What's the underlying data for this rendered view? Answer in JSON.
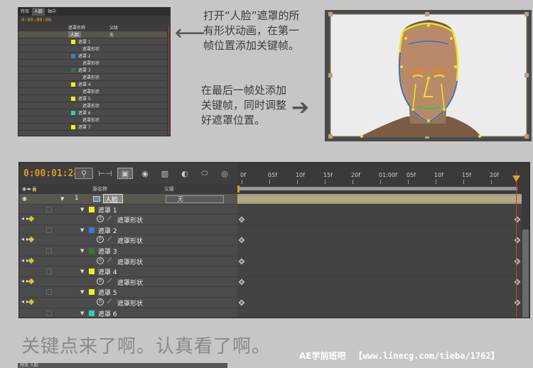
{
  "thumbnail": {
    "tabs": [
      "特效",
      "人脸",
      "轴中"
    ],
    "timecode": "0:00:00:00",
    "header_name": "遮罩名称",
    "header_parent": "父级",
    "layer_name": "人脸",
    "parent_value": "无",
    "rows": [
      {
        "type": "mask",
        "label": "遮罩 1",
        "color": "#f2f200"
      },
      {
        "type": "prop",
        "label": "遮罩形状"
      },
      {
        "type": "mask",
        "label": "遮罩 2",
        "color": "#2f7ed8"
      },
      {
        "type": "prop",
        "label": "遮罩形状"
      },
      {
        "type": "mask",
        "label": "遮罩 3",
        "color": "#2e7a2e"
      },
      {
        "type": "prop",
        "label": "遮罩形状"
      },
      {
        "type": "mask",
        "label": "遮罩 4",
        "color": "#f2f200"
      },
      {
        "type": "prop",
        "label": "遮罩形状"
      },
      {
        "type": "mask",
        "label": "遮罩 5",
        "color": "#f2f200"
      },
      {
        "type": "prop",
        "label": "遮罩形状"
      },
      {
        "type": "mask",
        "label": "遮罩 6",
        "color": "#27d3b5"
      },
      {
        "type": "prop",
        "label": "遮罩形状"
      },
      {
        "type": "mask",
        "label": "遮罩 7",
        "color": "#f2f200"
      }
    ]
  },
  "notes": {
    "note1": "打开“人脸”遮罩的所有形状动画，在第一帧位置添加关键帧。",
    "note2": "在最后一帧处添加关键帧，同时调整好遮罩位置。"
  },
  "timeline": {
    "timecode": "0:00:01:24",
    "toolbar_icons": [
      "search-icon",
      "comp-flowchart-icon",
      "draft-3d-icon",
      "shy-icon",
      "frame-blend-icon",
      "motion-blur-icon",
      "brainstorm-icon",
      "graph-editor-icon",
      "comp-flowchart-toggle-icon"
    ],
    "ruler_labels": [
      "0f",
      "05f",
      "10f",
      "15f",
      "20f",
      "01:00f",
      "05f",
      "10f",
      "15f",
      "20f"
    ],
    "header_name": "源名称",
    "header_parent": "父级",
    "layer": {
      "number": "1",
      "name": "人脸",
      "parent": "无"
    },
    "rows": [
      {
        "type": "mask",
        "label": "遮罩 1",
        "color": "#f2f200"
      },
      {
        "type": "prop",
        "label": "遮罩形状"
      },
      {
        "type": "mask",
        "label": "遮罩 2",
        "color": "#2f7ed8"
      },
      {
        "type": "prop",
        "label": "遮罩形状"
      },
      {
        "type": "mask",
        "label": "遮罩 3",
        "color": "#2e7a2e"
      },
      {
        "type": "prop",
        "label": "遮罩形状"
      },
      {
        "type": "mask",
        "label": "遮罩 4",
        "color": "#f2f200"
      },
      {
        "type": "prop",
        "label": "遮罩形状"
      },
      {
        "type": "mask",
        "label": "遮罩 5",
        "color": "#f2f200"
      },
      {
        "type": "prop",
        "label": "遮罩形状"
      },
      {
        "type": "mask",
        "label": "遮罩 6",
        "color": "#27d3b5"
      }
    ]
  },
  "footer": {
    "caption": "关键点来了啊。认真看了啊。",
    "brand": "AE学前班吧",
    "url": "【www.linecg.com/tieba/1762】",
    "strip": "特效  人脸"
  }
}
